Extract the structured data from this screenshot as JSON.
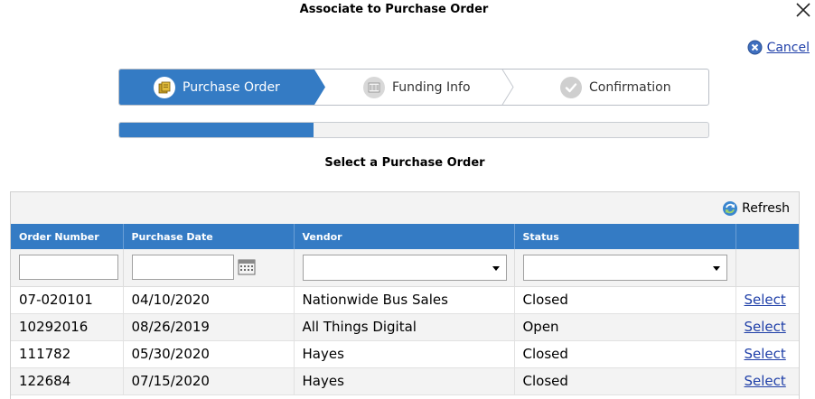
{
  "dialog": {
    "title": "Associate to Purchase Order",
    "close_icon": "close-x-icon",
    "cancel_label": "Cancel",
    "cancel_icon": "cancel-circle-icon"
  },
  "wizard": {
    "steps": [
      {
        "label": "Purchase Order",
        "icon": "purchase-order-icon",
        "active": true
      },
      {
        "label": "Funding Info",
        "icon": "funding-info-icon",
        "active": false
      },
      {
        "label": "Confirmation",
        "icon": "checkmark-icon",
        "active": false
      }
    ],
    "progress_fraction": 0.33
  },
  "section": {
    "title": "Select a Purchase Order"
  },
  "grid": {
    "refresh_label": "Refresh",
    "columns": [
      "Order Number",
      "Purchase Date",
      "Vendor",
      "Status",
      ""
    ],
    "filters": {
      "order_number": "",
      "purchase_date": "",
      "vendor": "",
      "status": ""
    },
    "rows": [
      {
        "order_number": "07-020101",
        "purchase_date": "04/10/2020",
        "vendor": "Nationwide Bus Sales",
        "status": "Closed",
        "action": "Select"
      },
      {
        "order_number": "10292016",
        "purchase_date": "08/26/2019",
        "vendor": "All Things Digital",
        "status": "Open",
        "action": "Select"
      },
      {
        "order_number": "111782",
        "purchase_date": "05/30/2020",
        "vendor": "Hayes",
        "status": "Closed",
        "action": "Select"
      },
      {
        "order_number": "122684",
        "purchase_date": "07/15/2020",
        "vendor": "Hayes",
        "status": "Closed",
        "action": "Select"
      }
    ]
  },
  "colors": {
    "accent": "#347bc4",
    "link": "#1f3fa8"
  }
}
